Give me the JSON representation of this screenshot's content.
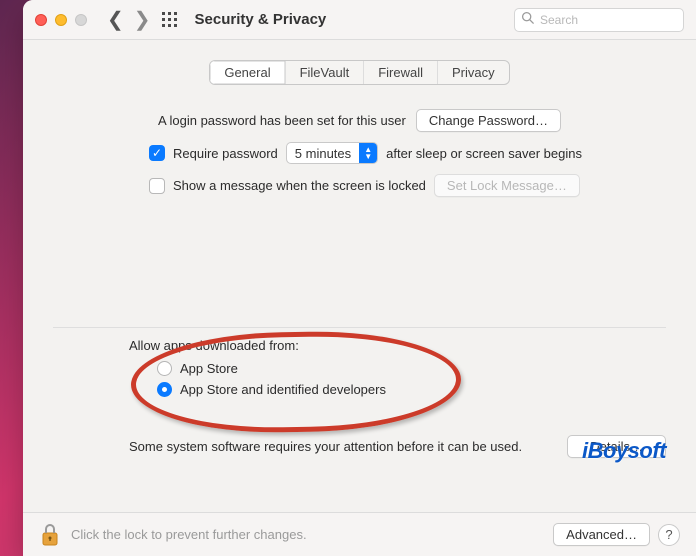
{
  "window": {
    "title": "Security & Privacy"
  },
  "search": {
    "placeholder": "Search",
    "value": ""
  },
  "tabs": [
    {
      "label": "General",
      "active": true
    },
    {
      "label": "FileVault",
      "active": false
    },
    {
      "label": "Firewall",
      "active": false
    },
    {
      "label": "Privacy",
      "active": false
    }
  ],
  "general": {
    "login_text": "A login password has been set for this user",
    "change_password_button": "Change Password…",
    "require_password_label": "Require password",
    "require_password_delay": "5 minutes",
    "require_password_suffix": "after sleep or screen saver begins",
    "require_password_checked": true,
    "show_message_label": "Show a message when the screen is locked",
    "show_message_checked": false,
    "set_lock_message_button": "Set Lock Message…"
  },
  "allow": {
    "title": "Allow apps downloaded from:",
    "options": [
      {
        "label": "App Store",
        "selected": false
      },
      {
        "label": "App Store and identified developers",
        "selected": true
      }
    ],
    "attention_text": "Some system software requires your attention before it can be used.",
    "details_button": "Details…"
  },
  "footer": {
    "lock_text": "Click the lock to prevent further changes.",
    "advanced_button": "Advanced…",
    "help_label": "?"
  },
  "watermark": "iBoysoft"
}
